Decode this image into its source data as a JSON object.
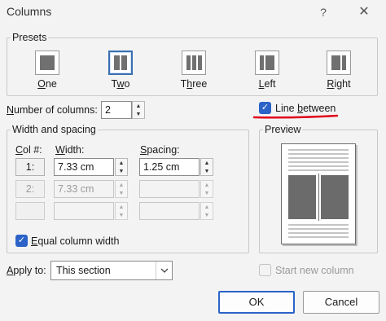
{
  "window": {
    "title": "Columns",
    "help_glyph": "?",
    "close_glyph": "✕"
  },
  "presets": {
    "legend": "Presets",
    "items": [
      {
        "label": "One",
        "underline": "O",
        "rest": "ne",
        "prefix": ""
      },
      {
        "label": "Two",
        "underline": "w",
        "rest": "o",
        "prefix": "T"
      },
      {
        "label": "Three",
        "underline": "h",
        "rest": "ree",
        "prefix": "T"
      },
      {
        "label": "Left",
        "underline": "L",
        "rest": "eft",
        "prefix": ""
      },
      {
        "label": "Right",
        "underline": "R",
        "rest": "ight",
        "prefix": ""
      }
    ],
    "selected": "Two"
  },
  "number_of_columns": {
    "label_u": "N",
    "label_rest": "umber of columns:",
    "value": "2"
  },
  "line_between": {
    "label_pre": "Line ",
    "label_u": "b",
    "label_rest": "etween",
    "checked": true,
    "underline_color": "#e0001a"
  },
  "width_spacing": {
    "legend": "Width and spacing",
    "col_header_u": "C",
    "col_header_rest": "ol #:",
    "width_header_u": "W",
    "width_header_rest": "idth:",
    "spacing_header_u": "S",
    "spacing_header_rest": "pacing:",
    "rows": [
      {
        "col": "1:",
        "width": "7.33 cm",
        "spacing": "1.25 cm"
      },
      {
        "col": "2:",
        "width": "7.33 cm",
        "spacing": ""
      },
      {
        "col": "",
        "width": "",
        "spacing": ""
      }
    ]
  },
  "equal_column_width": {
    "label_u": "E",
    "label_rest": "qual column width",
    "checked": true
  },
  "preview": {
    "legend": "Preview"
  },
  "apply_to": {
    "label_u": "A",
    "label_rest": "pply to:",
    "value": "This section"
  },
  "start_new_column": {
    "label": "Start new column",
    "checked": false
  },
  "buttons": {
    "ok": "OK",
    "cancel": "Cancel"
  },
  "colors": {
    "accent": "#2b63c8",
    "red_underline": "#e0001a"
  }
}
